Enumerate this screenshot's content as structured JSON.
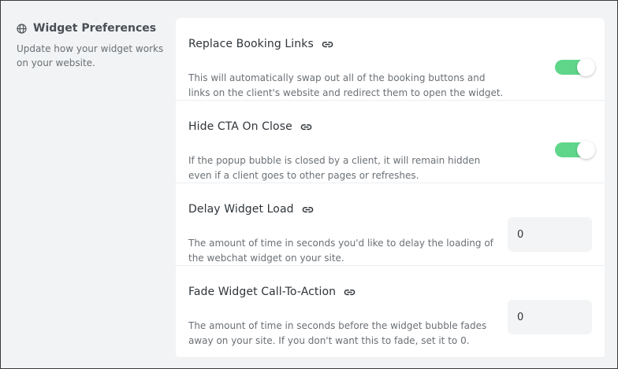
{
  "section": {
    "icon": "globe-icon",
    "title": "Widget Preferences",
    "description": "Update how your widget works on your website."
  },
  "settings": [
    {
      "title": "Replace Booking Links",
      "icon": "link-icon",
      "description": "This will automatically swap out all of the booking buttons and links on the client's website and redirect them to open the widget.",
      "control": "toggle",
      "enabled": true
    },
    {
      "title": "Hide CTA On Close",
      "icon": "link-icon",
      "description": "If the popup bubble is closed by a client, it will remain hidden even if a client goes to other pages or refreshes.",
      "control": "toggle",
      "enabled": true
    },
    {
      "title": "Delay Widget Load",
      "icon": "link-icon",
      "description": "The amount of time in seconds you'd like to delay the loading of the webchat widget on your site.",
      "control": "number",
      "value": "0"
    },
    {
      "title": "Fade Widget Call-To-Action",
      "icon": "link-icon",
      "description": "The amount of time in seconds before the widget bubble fades away on your site. If you don't want this to fade, set it to 0.",
      "control": "number",
      "value": "0"
    }
  ],
  "colors": {
    "toggle_on": "#5fd68a",
    "background": "#f1f3f4",
    "card": "#ffffff"
  }
}
